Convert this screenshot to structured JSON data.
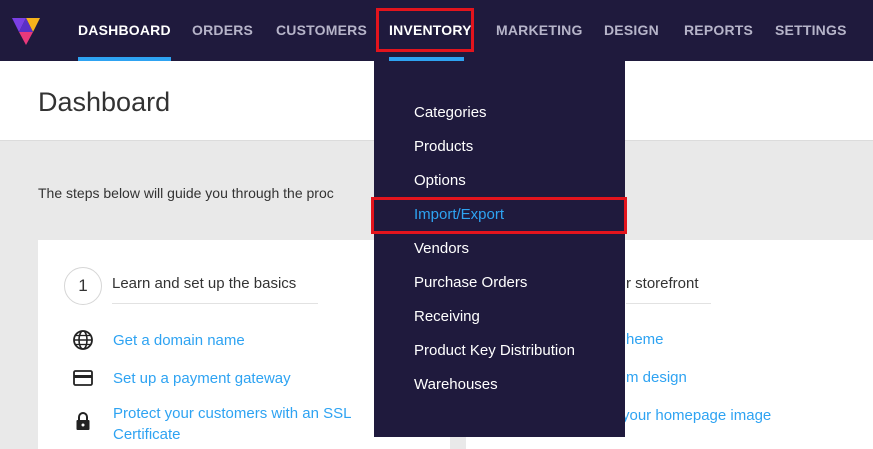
{
  "nav": {
    "items": [
      {
        "label": "DASHBOARD"
      },
      {
        "label": "ORDERS"
      },
      {
        "label": "CUSTOMERS"
      },
      {
        "label": "INVENTORY"
      },
      {
        "label": "MARKETING"
      },
      {
        "label": "DESIGN"
      },
      {
        "label": "REPORTS"
      },
      {
        "label": "SETTINGS"
      }
    ],
    "active": "DASHBOARD",
    "open_menu": "INVENTORY"
  },
  "page": {
    "title": "Dashboard",
    "intro": "The steps below will guide you through the proc"
  },
  "steps": {
    "learn": {
      "number": "1",
      "title": "Learn and set up the basics",
      "links": [
        {
          "icon": "globe-icon",
          "label": "Get a domain name"
        },
        {
          "icon": "credit-card-icon",
          "label": "Set up a payment gateway"
        },
        {
          "icon": "lock-icon",
          "label": "Protect your customers with an SSL",
          "label2": "Certificate"
        }
      ]
    },
    "storefront": {
      "title_partial": "r storefront",
      "links_partial": [
        "heme",
        "m design",
        "your homepage image"
      ]
    }
  },
  "inventory_menu": {
    "items": [
      {
        "label": "Categories"
      },
      {
        "label": "Products"
      },
      {
        "label": "Options"
      },
      {
        "label": "Import/Export"
      },
      {
        "label": "Vendors"
      },
      {
        "label": "Purchase Orders"
      },
      {
        "label": "Receiving"
      },
      {
        "label": "Product Key Distribution"
      },
      {
        "label": "Warehouses"
      }
    ],
    "selected": "Import/Export"
  },
  "colors": {
    "nav_bg": "#1f1a3d",
    "accent": "#2ea3f2",
    "highlight": "#e3141d"
  }
}
